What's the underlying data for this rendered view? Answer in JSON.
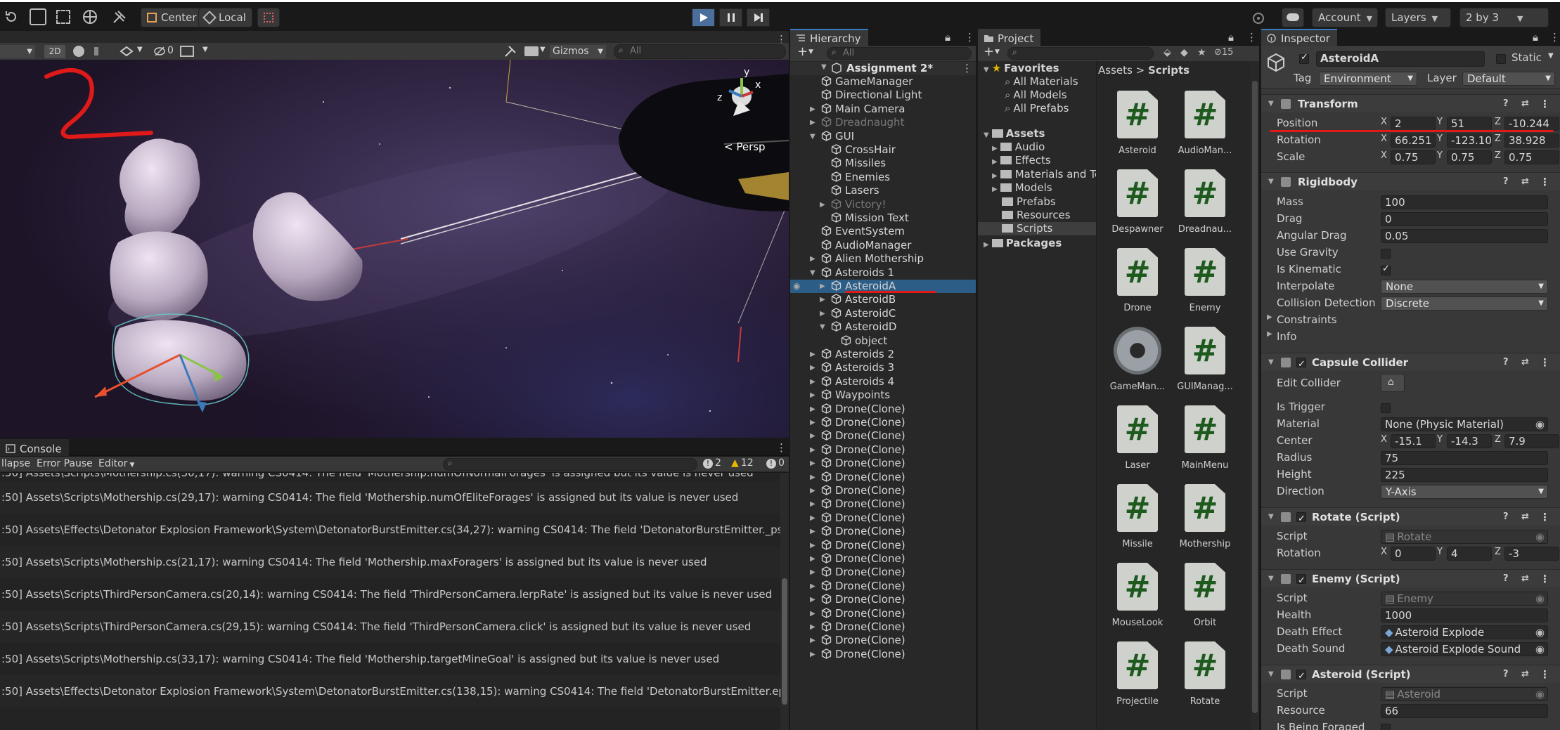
{
  "toolbar": {
    "pivot_label": "Center",
    "space_label": "Local",
    "account_label": "Account",
    "layers_label": "Layers",
    "layout_label": "2 by 3"
  },
  "scene": {
    "mode_2d": "2D",
    "gizmos_label": "Gizmos",
    "search_placeholder": "All",
    "hidden_count": "0",
    "persp_label": "< Persp",
    "axis_y": "y",
    "axis_z": "z",
    "axis_x": "x",
    "annotation": "2"
  },
  "hierarchy": {
    "tab": "Hierarchy",
    "search_placeholder": "All",
    "scene_name": "Assignment 2*",
    "items": [
      {
        "label": "GameManager",
        "depth": 1,
        "fold": false,
        "dim": false
      },
      {
        "label": "Directional Light",
        "depth": 1,
        "fold": false,
        "dim": false
      },
      {
        "label": "Main Camera",
        "depth": 1,
        "fold": true,
        "dim": false
      },
      {
        "label": "Dreadnaught",
        "depth": 1,
        "fold": true,
        "dim": true
      },
      {
        "label": "GUI",
        "depth": 1,
        "fold": "open",
        "dim": false
      },
      {
        "label": "CrossHair",
        "depth": 2,
        "fold": false,
        "dim": false
      },
      {
        "label": "Missiles",
        "depth": 2,
        "fold": false,
        "dim": false
      },
      {
        "label": "Enemies",
        "depth": 2,
        "fold": false,
        "dim": false
      },
      {
        "label": "Lasers",
        "depth": 2,
        "fold": false,
        "dim": false
      },
      {
        "label": "Victory!",
        "depth": 2,
        "fold": true,
        "dim": true
      },
      {
        "label": "Mission Text",
        "depth": 2,
        "fold": false,
        "dim": false
      },
      {
        "label": "EventSystem",
        "depth": 1,
        "fold": false,
        "dim": false
      },
      {
        "label": "AudioManager",
        "depth": 1,
        "fold": false,
        "dim": false
      },
      {
        "label": "Alien Mothership",
        "depth": 1,
        "fold": true,
        "dim": false
      },
      {
        "label": "Asteroids 1",
        "depth": 1,
        "fold": "open",
        "dim": false
      },
      {
        "label": "AsteroidA",
        "depth": 2,
        "fold": true,
        "dim": false,
        "selected": true
      },
      {
        "label": "AsteroidB",
        "depth": 2,
        "fold": true,
        "dim": false
      },
      {
        "label": "AsteroidC",
        "depth": 2,
        "fold": true,
        "dim": false
      },
      {
        "label": "AsteroidD",
        "depth": 2,
        "fold": "open",
        "dim": false
      },
      {
        "label": "object",
        "depth": 3,
        "fold": false,
        "dim": false
      },
      {
        "label": "Asteroids 2",
        "depth": 1,
        "fold": true,
        "dim": false
      },
      {
        "label": "Asteroids 3",
        "depth": 1,
        "fold": true,
        "dim": false
      },
      {
        "label": "Asteroids 4",
        "depth": 1,
        "fold": true,
        "dim": false
      },
      {
        "label": "Waypoints",
        "depth": 1,
        "fold": true,
        "dim": false
      },
      {
        "label": "Drone(Clone)",
        "depth": 1,
        "fold": true,
        "dim": false
      },
      {
        "label": "Drone(Clone)",
        "depth": 1,
        "fold": true,
        "dim": false
      },
      {
        "label": "Drone(Clone)",
        "depth": 1,
        "fold": true,
        "dim": false
      },
      {
        "label": "Drone(Clone)",
        "depth": 1,
        "fold": true,
        "dim": false
      },
      {
        "label": "Drone(Clone)",
        "depth": 1,
        "fold": true,
        "dim": false
      },
      {
        "label": "Drone(Clone)",
        "depth": 1,
        "fold": true,
        "dim": false
      },
      {
        "label": "Drone(Clone)",
        "depth": 1,
        "fold": true,
        "dim": false
      },
      {
        "label": "Drone(Clone)",
        "depth": 1,
        "fold": true,
        "dim": false
      },
      {
        "label": "Drone(Clone)",
        "depth": 1,
        "fold": true,
        "dim": false
      },
      {
        "label": "Drone(Clone)",
        "depth": 1,
        "fold": true,
        "dim": false
      },
      {
        "label": "Drone(Clone)",
        "depth": 1,
        "fold": true,
        "dim": false
      },
      {
        "label": "Drone(Clone)",
        "depth": 1,
        "fold": true,
        "dim": false
      },
      {
        "label": "Drone(Clone)",
        "depth": 1,
        "fold": true,
        "dim": false
      },
      {
        "label": "Drone(Clone)",
        "depth": 1,
        "fold": true,
        "dim": false
      },
      {
        "label": "Drone(Clone)",
        "depth": 1,
        "fold": true,
        "dim": false
      },
      {
        "label": "Drone(Clone)",
        "depth": 1,
        "fold": true,
        "dim": false
      },
      {
        "label": "Drone(Clone)",
        "depth": 1,
        "fold": true,
        "dim": false
      },
      {
        "label": "Drone(Clone)",
        "depth": 1,
        "fold": true,
        "dim": false
      },
      {
        "label": "Drone(Clone)",
        "depth": 1,
        "fold": true,
        "dim": false
      }
    ]
  },
  "project": {
    "tab": "Project",
    "hidden_count": "15",
    "favorites_label": "Favorites",
    "favorites": [
      "All Materials",
      "All Models",
      "All Prefabs"
    ],
    "assets_label": "Assets",
    "asset_folders": [
      "Audio",
      "Effects",
      "Materials and Te",
      "Models",
      "Prefabs",
      "Resources",
      "Scripts"
    ],
    "packages_label": "Packages",
    "breadcrumb_root": "Assets",
    "breadcrumb_sep": ">",
    "breadcrumb_current": "Scripts",
    "scripts": [
      {
        "name": "Asteroid",
        "icon": "#"
      },
      {
        "name": "AudioMan...",
        "icon": "#"
      },
      {
        "name": "Despawner",
        "icon": "#"
      },
      {
        "name": "Dreadnau...",
        "icon": "#"
      },
      {
        "name": "Drone",
        "icon": "#"
      },
      {
        "name": "Enemy",
        "icon": "#"
      },
      {
        "name": "GameMan...",
        "icon": "gear"
      },
      {
        "name": "GUIManag...",
        "icon": "#"
      },
      {
        "name": "Laser",
        "icon": "#"
      },
      {
        "name": "MainMenu",
        "icon": "#"
      },
      {
        "name": "Missile",
        "icon": "#"
      },
      {
        "name": "Mothership",
        "icon": "#"
      },
      {
        "name": "MouseLook",
        "icon": "#"
      },
      {
        "name": "Orbit",
        "icon": "#"
      },
      {
        "name": "Projectile",
        "icon": "#"
      },
      {
        "name": "Rotate",
        "icon": "#"
      }
    ]
  },
  "console": {
    "tab": "Console",
    "collapse_label": "llapse",
    "error_pause_label": "Error Pause",
    "editor_label": "Editor",
    "info_count": "2",
    "warn_count": "12",
    "error_count": "0",
    "top_partial": ":50] Assets\\Scripts\\Mothership.cs(30,17): warning CS0414: The field 'Mothership.numOfNormalForages' is assigned but its value is never used",
    "lines": [
      ":50] Assets\\Scripts\\Mothership.cs(29,17): warning CS0414: The field 'Mothership.numOfEliteForages' is assigned but its value is never used",
      ":50] Assets\\Effects\\Detonator Explosion Framework\\System\\DetonatorBurstEmitter.cs(34,27): warning CS0414: The field 'DetonatorBurstEmitter._psRenderMode' is a",
      ":50] Assets\\Scripts\\Mothership.cs(21,17): warning CS0414: The field 'Mothership.maxForagers' is assigned but its value is never used",
      ":50] Assets\\Scripts\\ThirdPersonCamera.cs(20,14): warning CS0414: The field 'ThirdPersonCamera.lerpRate' is assigned but its value is never used",
      ":50] Assets\\Scripts\\ThirdPersonCamera.cs(29,15): warning CS0414: The field 'ThirdPersonCamera.click' is assigned but its value is never used",
      ":50] Assets\\Scripts\\Mothership.cs(33,17): warning CS0414: The field 'Mothership.targetMineGoal' is assigned but its value is never used",
      ":50] Assets\\Effects\\Detonator Explosion Framework\\System\\DetonatorBurstEmitter.cs(138,15): warning CS0414: The field 'DetonatorBurstEmitter.epsilon' is assigned"
    ]
  },
  "inspector": {
    "tab": "Inspector",
    "object_name": "AsteroidA",
    "static_label": "Static",
    "tag_label": "Tag",
    "tag_value": "Environment",
    "layer_label": "Layer",
    "layer_value": "Default",
    "transform": {
      "title": "Transform",
      "position_label": "Position",
      "pos": {
        "x": "2",
        "y": "51",
        "z": "-10.244"
      },
      "rotation_label": "Rotation",
      "rot": {
        "x": "66.251",
        "y": "-123.10",
        "z": "38.928"
      },
      "scale_label": "Scale",
      "scl": {
        "x": "0.75",
        "y": "0.75",
        "z": "0.75"
      }
    },
    "rigidbody": {
      "title": "Rigidbody",
      "mass_label": "Mass",
      "mass": "100",
      "drag_label": "Drag",
      "drag": "0",
      "angular_drag_label": "Angular Drag",
      "angular_drag": "0.05",
      "use_gravity_label": "Use Gravity",
      "is_kinematic_label": "Is Kinematic",
      "interpolate_label": "Interpolate",
      "interpolate": "None",
      "collision_label": "Collision Detection",
      "collision": "Discrete",
      "constraints_label": "Constraints",
      "info_label": "Info"
    },
    "capsule": {
      "title": "Capsule Collider",
      "edit_label": "Edit Collider",
      "trigger_label": "Is Trigger",
      "material_label": "Material",
      "material": "None (Physic Material)",
      "center_label": "Center",
      "center": {
        "x": "-15.1",
        "y": "-14.3",
        "z": "7.9"
      },
      "radius_label": "Radius",
      "radius": "75",
      "height_label": "Height",
      "height": "225",
      "direction_label": "Direction",
      "direction": "Y-Axis"
    },
    "rotate": {
      "title": "Rotate (Script)",
      "script_label": "Script",
      "script": "Rotate",
      "rotation_label": "Rotation",
      "rot": {
        "x": "0",
        "y": "4",
        "z": "-3"
      }
    },
    "enemy": {
      "title": "Enemy (Script)",
      "script_label": "Script",
      "script": "Enemy",
      "health_label": "Health",
      "health": "1000",
      "death_effect_label": "Death Effect",
      "death_effect": "Asteroid Explode",
      "death_sound_label": "Death Sound",
      "death_sound": "Asteroid Explode Sound"
    },
    "asteroid": {
      "title": "Asteroid (Script)",
      "script_label": "Script",
      "script": "Asteroid",
      "resource_label": "Resource",
      "resource": "66",
      "foraged_label": "Is Being Foraged"
    }
  },
  "colors": {
    "accent": "#3a79bb",
    "selection": "#2c5d87",
    "annotation_red": "#e01919",
    "warn": "#e6b800"
  }
}
